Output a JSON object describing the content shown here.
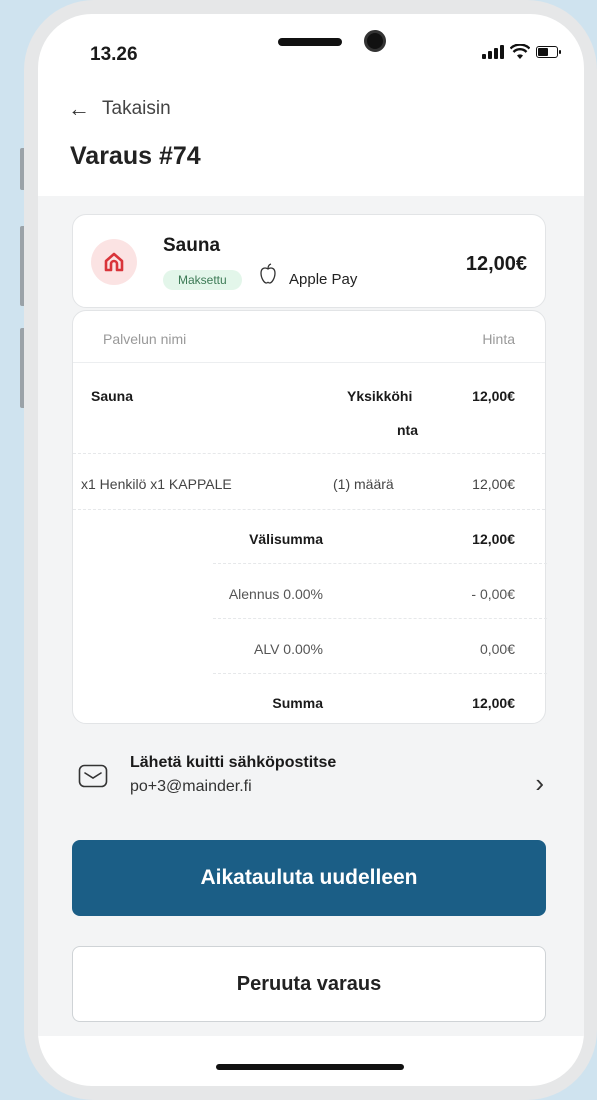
{
  "status": {
    "time": "13.26"
  },
  "nav": {
    "back_label": "Takaisin",
    "title": "Varaus #74"
  },
  "service": {
    "name": "Sauna",
    "status_badge": "Maksettu",
    "payment_method": "Apple Pay",
    "price": "12,00€",
    "icon": "home-icon",
    "icon_color": "#d9343a"
  },
  "details": {
    "header_left": "Palvelun nimi",
    "header_right": "Hinta",
    "item_name": "Sauna",
    "unit_label_line1": "Yksikköhi",
    "unit_label_line2": "nta",
    "unit_price": "12,00€",
    "line_desc": "x1 Henkilö x1 KAPPALE",
    "line_qty": "(1) määrä",
    "line_price": "12,00€",
    "subtotal_label": "Välisumma",
    "subtotal_value": "12,00€",
    "discount_label": "Alennus 0.00%",
    "discount_value": "- 0,00€",
    "vat_label": "ALV 0.00%",
    "vat_value": "0,00€",
    "total_label": "Summa",
    "total_value": "12,00€"
  },
  "receipt": {
    "title": "Lähetä kuitti sähköpostitse",
    "email": "po+3@mainder.fi"
  },
  "actions": {
    "reschedule": "Aikatauluta uudelleen",
    "cancel": "Peruuta varaus"
  },
  "colors": {
    "primary": "#1b5e86",
    "paid_green": "#3c7a55"
  }
}
